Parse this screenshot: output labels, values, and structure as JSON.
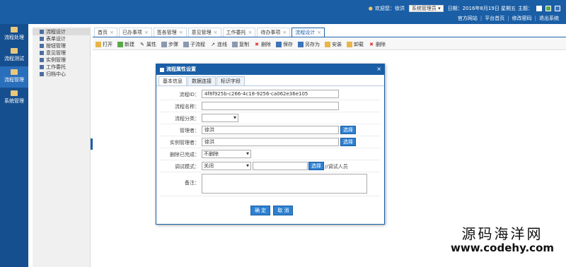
{
  "topbar": {
    "welcome": "欢迎您：徐洪",
    "role": "系统管理员",
    "date": "日期：2016年8月19日 星期五",
    "theme_label": "主题：",
    "theme_colors": [
      "#ffffff",
      "#5aa84a",
      "#3f74b8"
    ],
    "links": [
      "官方网站",
      "平台首页",
      "修改密码",
      "退出系统"
    ]
  },
  "leftnav": {
    "items": [
      "流程处理",
      "流程测试",
      "流程管理",
      "系统管理"
    ]
  },
  "secnav": {
    "items": [
      "流程设计",
      "表单设计",
      "按钮管理",
      "意见管理",
      "实例管理",
      "工作委托",
      "归档中心"
    ]
  },
  "tabs": [
    "首页",
    "已办事项",
    "签各管理",
    "意见管理",
    "工作委托",
    "待办事项",
    "流程设计"
  ],
  "toolbar": [
    "打开",
    "新建",
    "属性",
    "步骤",
    "子流程",
    "连线",
    "复制",
    "删除",
    "保存",
    "另存为",
    "安装",
    "卸载",
    "删除"
  ],
  "dialog": {
    "title": "流程属性设置",
    "close": "×",
    "tabs": [
      "基本信息",
      "数据连接",
      "标识字段"
    ],
    "fields": {
      "id_label": "流程ID：",
      "id_value": "4f8f925b-c266-4c18-9256-ca062e36e105",
      "name_label": "流程名称：",
      "category_label": "流程分类：",
      "manager_label": "管理者：",
      "manager_value": "徐洪",
      "instance_label": "实例管理者：",
      "instance_value": "徐洪",
      "delete_label": "删除已完成：",
      "delete_value": "不删除",
      "debug_label": "调试模式：",
      "debug_value": "关闭",
      "debug_note": "//调试人员",
      "remark_label": "备注：",
      "pick": "选择"
    },
    "buttons": {
      "ok": "确 定",
      "cancel": "取 消"
    }
  },
  "watermark": {
    "line1": "源码海洋网",
    "line2": "www.codehy.com"
  }
}
